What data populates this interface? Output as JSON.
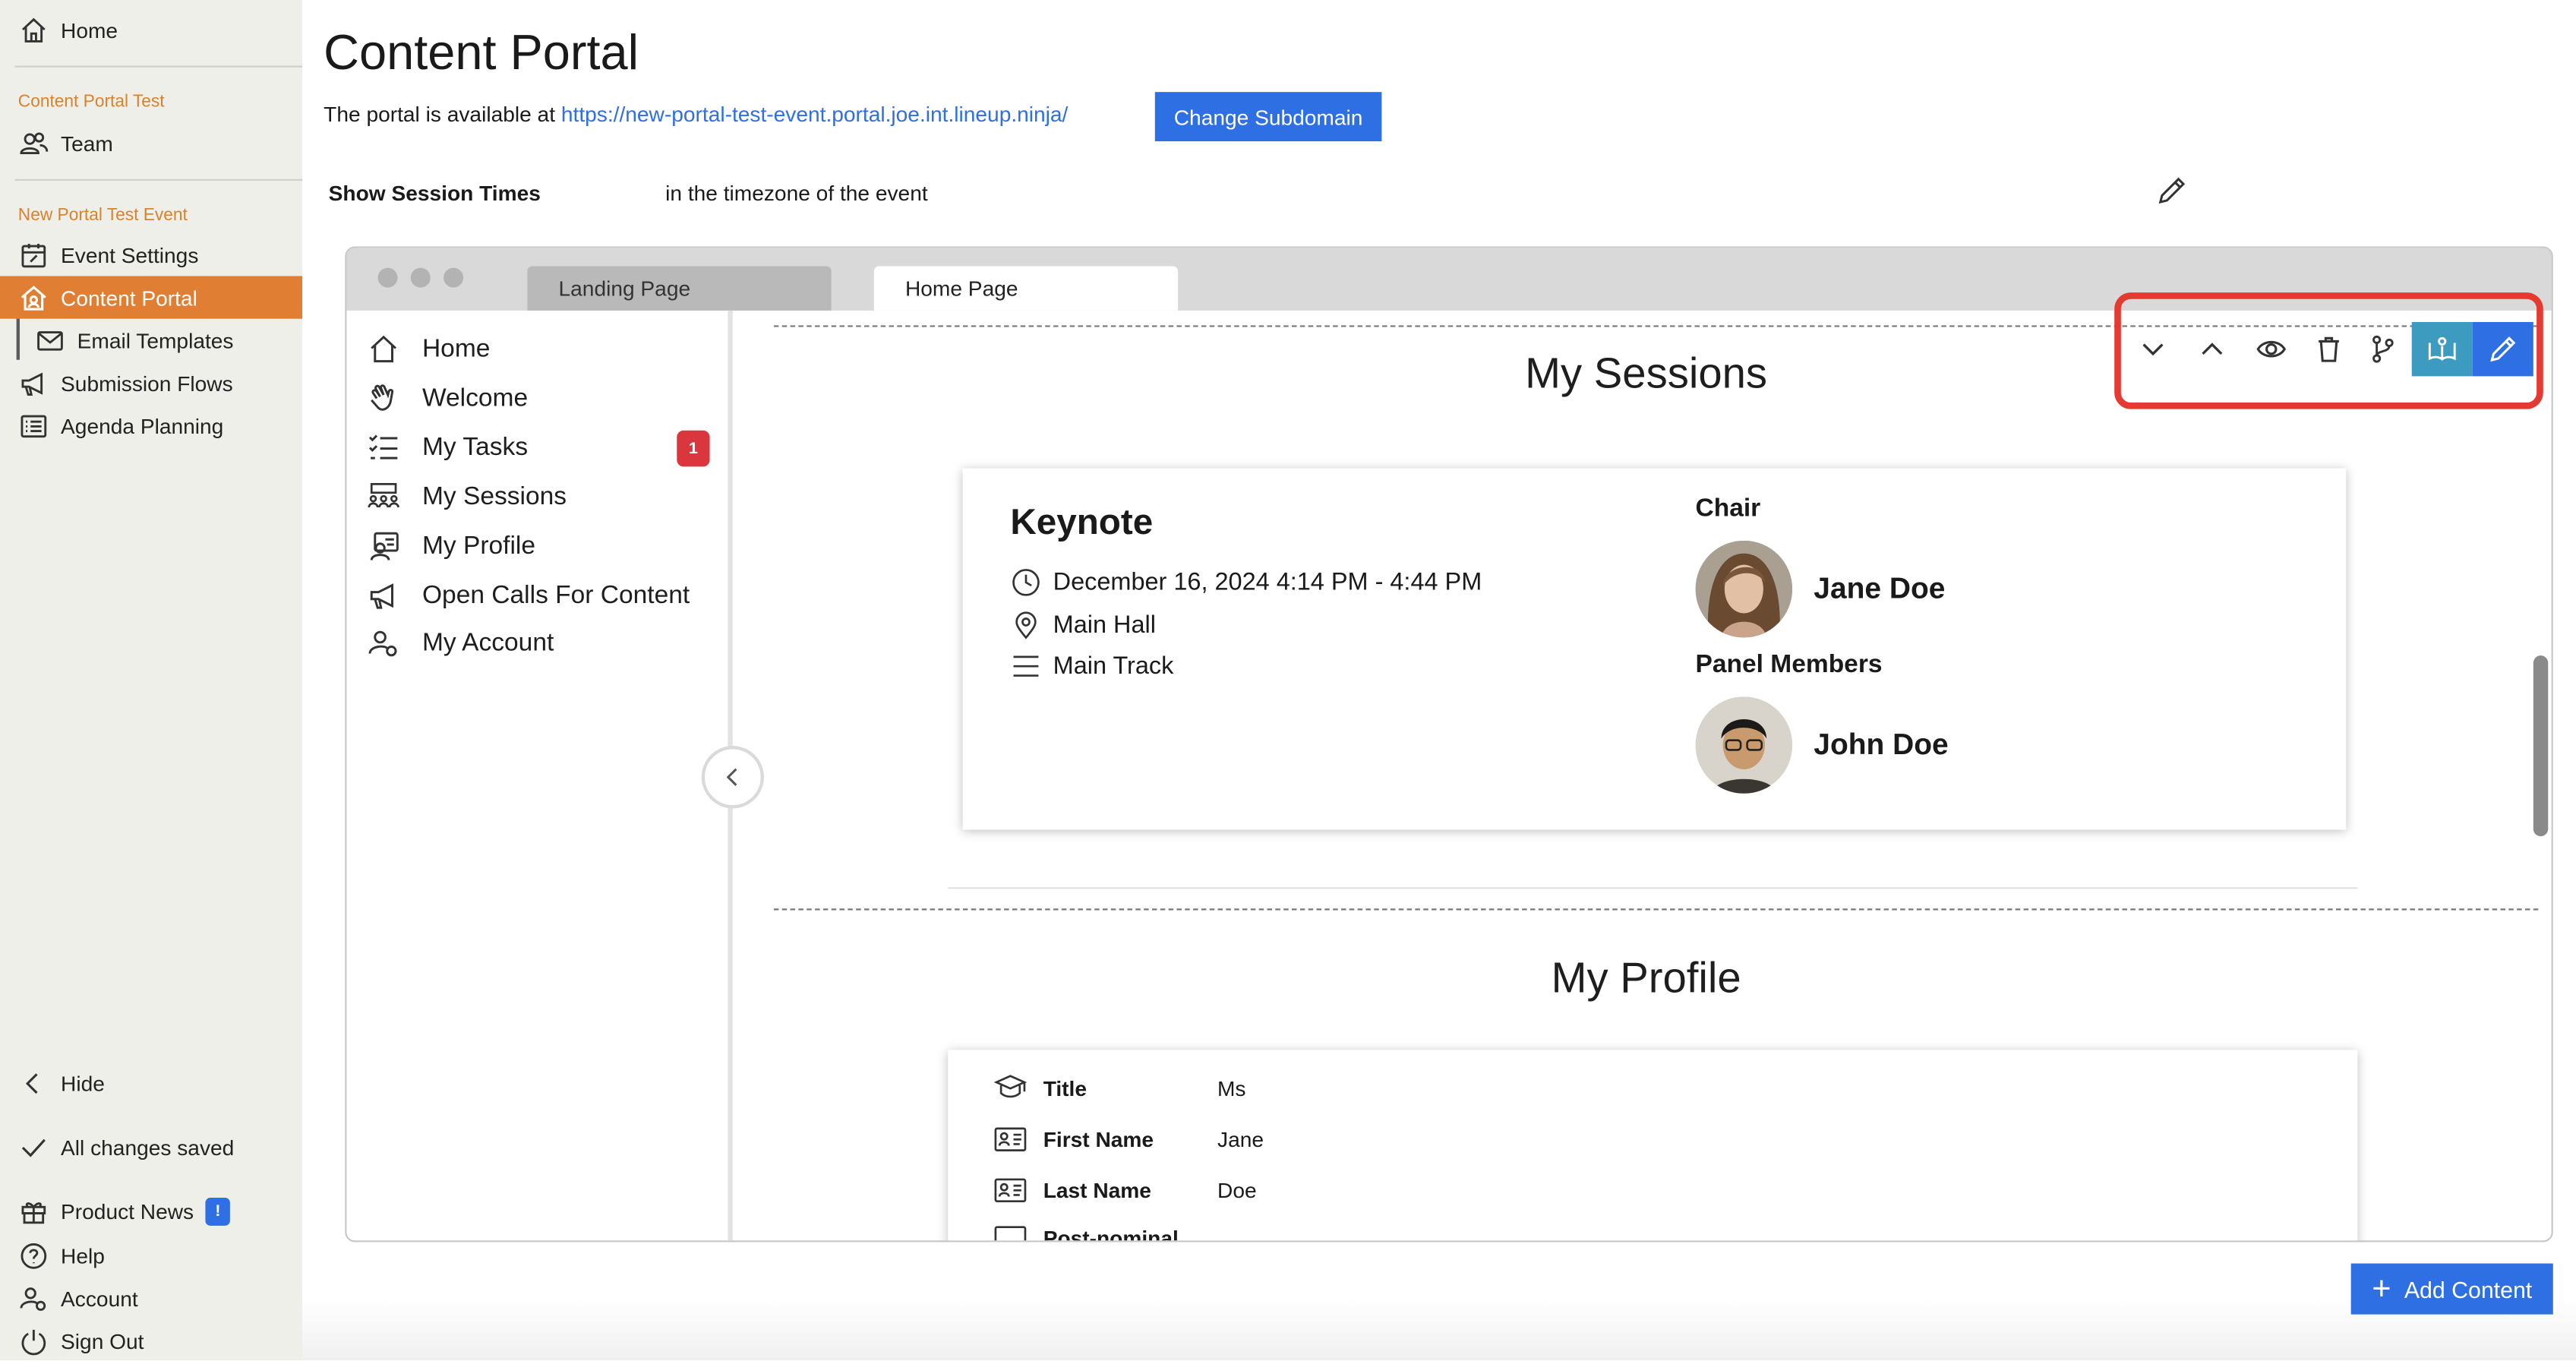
{
  "sidebar": {
    "home_label": "Home",
    "group1": "Content Portal Test",
    "team_label": "Team",
    "group2": "New Portal Test Event",
    "items": [
      {
        "label": "Event Settings"
      },
      {
        "label": "Content Portal"
      },
      {
        "label": "Email Templates"
      },
      {
        "label": "Submission Flows"
      },
      {
        "label": "Agenda Planning"
      }
    ],
    "hide_label": "Hide",
    "saved_label": "All changes saved",
    "news_label": "Product News",
    "news_badge": "!",
    "help_label": "Help",
    "account_label": "Account",
    "signout_label": "Sign Out"
  },
  "header": {
    "title": "Content Portal",
    "available_text": "The portal is available at",
    "url": "https://new-portal-test-event.portal.joe.int.lineup.ninja/",
    "change_button": "Change Subdomain"
  },
  "setting": {
    "label": "Show Session Times",
    "value": "in the timezone of the event"
  },
  "preview": {
    "tabs": [
      "Landing Page",
      "Home Page"
    ],
    "nav": [
      {
        "label": "Home",
        "icon": "home-icon"
      },
      {
        "label": "Welcome",
        "icon": "hand-wave-icon"
      },
      {
        "label": "My Tasks",
        "icon": "checklist-icon",
        "badge": "1"
      },
      {
        "label": "My Sessions",
        "icon": "audience-icon"
      },
      {
        "label": "My Profile",
        "icon": "profile-icon"
      },
      {
        "label": "Open Calls For Content",
        "icon": "megaphone-icon"
      },
      {
        "label": "My Account",
        "icon": "account-gear-icon"
      }
    ],
    "sessions": {
      "title": "My Sessions",
      "session_title": "Keynote",
      "datetime": "December 16, 2024 4:14 PM - 4:44 PM",
      "location": "Main Hall",
      "track": "Main Track",
      "chair_label": "Chair",
      "chair_name": "Jane Doe",
      "panel_label": "Panel Members",
      "panel_name": "John Doe"
    },
    "profile": {
      "title": "My Profile",
      "rows": [
        {
          "key": "Title",
          "value": "Ms"
        },
        {
          "key": "First Name",
          "value": "Jane"
        },
        {
          "key": "Last Name",
          "value": "Doe"
        },
        {
          "key": "Post-nominal",
          "value": ""
        }
      ]
    }
  },
  "toolbar_icons": [
    "chevron-down-icon",
    "chevron-up-icon",
    "eye-icon",
    "trash-icon",
    "branch-icon",
    "book-icon",
    "pencil-icon"
  ],
  "add_content": "Add Content",
  "colors": {
    "accent": "#e07f33",
    "primary": "#2f6fe4",
    "highlight": "#e53a32",
    "teal": "#3d9bbf"
  }
}
